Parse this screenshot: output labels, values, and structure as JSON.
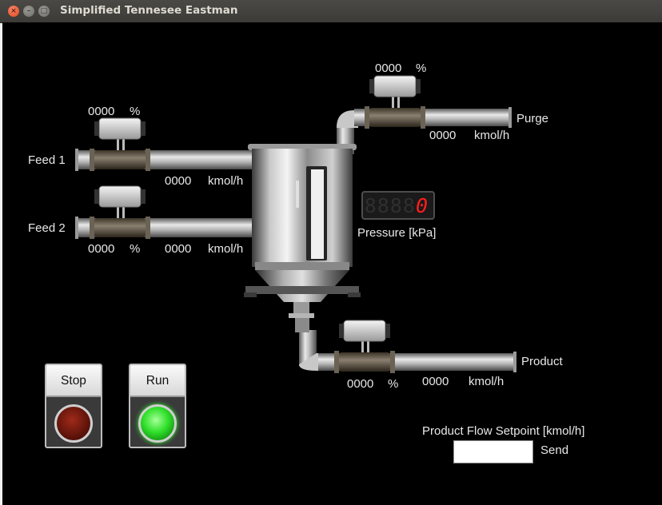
{
  "window": {
    "title": "Simplified Tennesee Eastman",
    "close_glyph": "×",
    "minimize_glyph": "–",
    "maximize_glyph": "□"
  },
  "labels": {
    "feed1": "Feed 1",
    "feed2": "Feed 2",
    "purge": "Purge",
    "product": "Product"
  },
  "valves": {
    "feed1": {
      "opening": "0000",
      "unit": "%"
    },
    "feed2": {
      "opening": "0000",
      "unit": "%"
    },
    "purge": {
      "opening": "0000",
      "unit": "%"
    },
    "product": {
      "opening": "0000",
      "unit": "%"
    }
  },
  "flows": {
    "feed1": {
      "value": "0000",
      "unit": "kmol/h"
    },
    "feed2": {
      "value": "0000",
      "unit": "kmol/h"
    },
    "purge": {
      "value": "0000",
      "unit": "kmol/h"
    },
    "product": {
      "value": "0000",
      "unit": "kmol/h"
    }
  },
  "pressure": {
    "ghost": "8888",
    "value": "0",
    "label": "Pressure [kPa]"
  },
  "controls": {
    "stop_label": "Stop",
    "run_label": "Run",
    "setpoint_label": "Product Flow Setpoint [kmol/h]",
    "setpoint_value": "",
    "send_label": "Send"
  },
  "colors": {
    "background": "#000000",
    "text": "#e8e8e8",
    "pressure_digit": "#ff1e1e",
    "run_lamp": "#2fe02a",
    "stop_lamp": "#5a1209"
  }
}
